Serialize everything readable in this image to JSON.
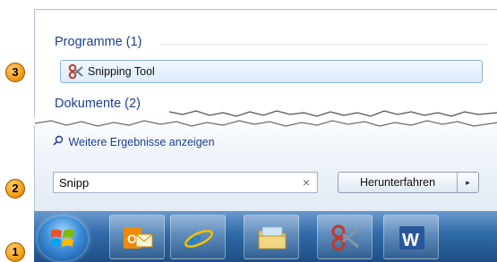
{
  "start_menu": {
    "programs_heading": "Programme (1)",
    "programs": [
      {
        "label": "Snipping Tool",
        "icon": "scissors-icon"
      }
    ],
    "documents_heading": "Dokumente (2)",
    "more_results": "Weitere Ergebnisse anzeigen",
    "search": {
      "value": "Snipp",
      "clear_icon": "×"
    },
    "shutdown": {
      "label": "Herunterfahren",
      "arrow": "▸"
    }
  },
  "taskbar": {
    "apps": [
      {
        "name": "outlook",
        "icon": "outlook-icon"
      },
      {
        "name": "internet-explorer",
        "icon": "internet-explorer-icon"
      },
      {
        "name": "file-explorer",
        "icon": "folder-icon"
      },
      {
        "name": "snipping-tool",
        "icon": "scissors-icon"
      },
      {
        "name": "word",
        "icon": "word-icon"
      }
    ]
  },
  "callouts": [
    "1",
    "2",
    "3"
  ],
  "colors": {
    "heading_blue": "#1e3f8f",
    "highlight_border": "#8cb5dd",
    "callout_orange": "#f7a21b"
  }
}
